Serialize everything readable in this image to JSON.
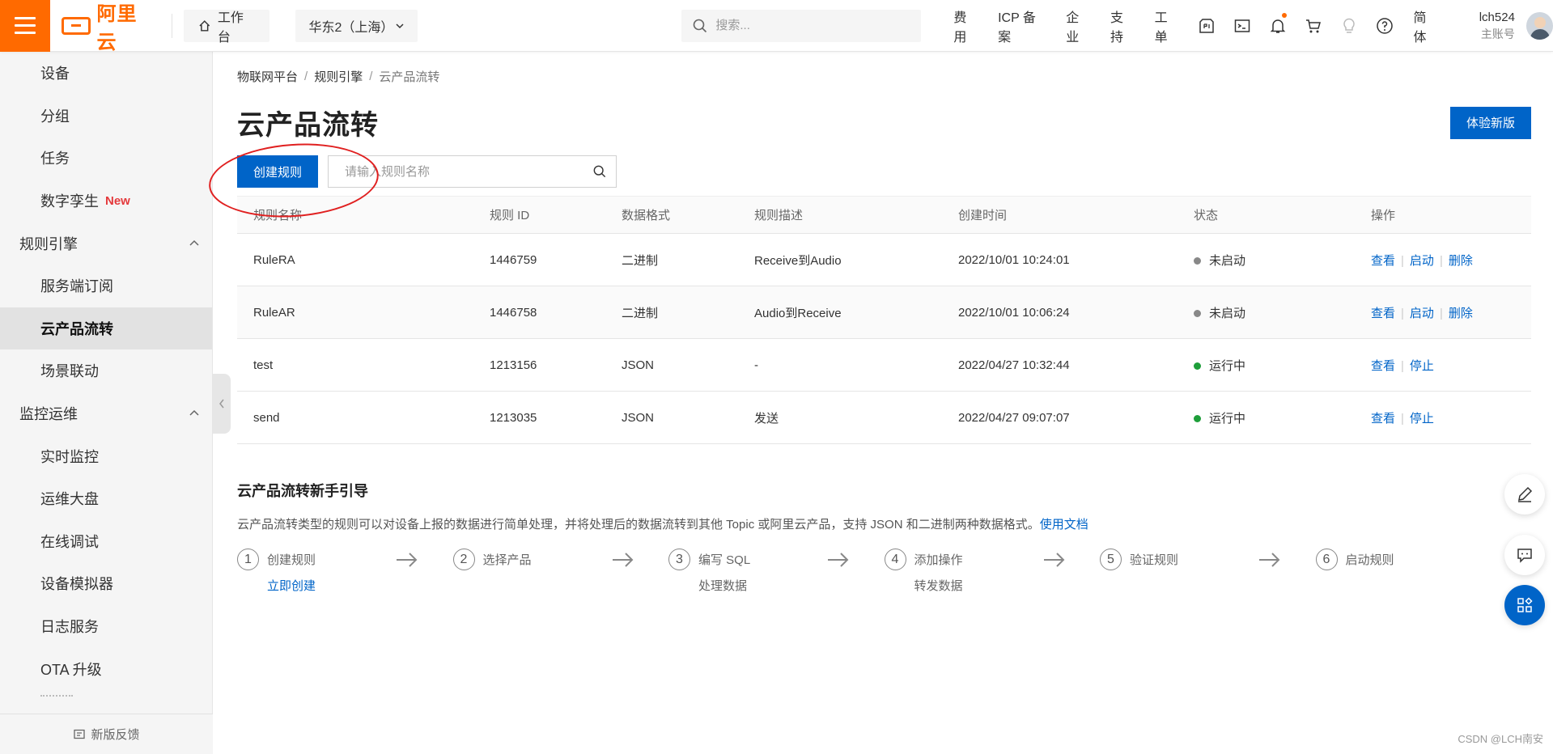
{
  "topbar": {
    "logo_text": "阿里云",
    "workbench": "工作台",
    "region": "华东2（上海）",
    "search_placeholder": "搜索...",
    "nav": [
      "费用",
      "ICP 备案",
      "企业",
      "支持",
      "工单"
    ],
    "lang": "简体",
    "account_name": "lch524",
    "account_role": "主账号",
    "accent": "#ff6a00"
  },
  "sidebar": {
    "items_top": [
      "设备",
      "分组",
      "任务"
    ],
    "digital_twin": "数字孪生",
    "new_badge": "New",
    "group_rules": "规则引擎",
    "rules_items": [
      "服务端订阅",
      "云产品流转",
      "场景联动"
    ],
    "group_ops": "监控运维",
    "ops_items": [
      "实时监控",
      "运维大盘",
      "在线调试",
      "设备模拟器",
      "日志服务",
      "OTA 升级"
    ],
    "feedback": "新版反馈"
  },
  "main": {
    "breadcrumb": [
      "物联网平台",
      "规则引擎",
      "云产品流转"
    ],
    "title": "云产品流转",
    "try_new_button": "体验新版",
    "create_button": "创建规则",
    "search_placeholder": "请输入规则名称",
    "primary_color": "#0064c8",
    "table": {
      "headers": [
        "规则名称",
        "规则 ID",
        "数据格式",
        "规则描述",
        "创建时间",
        "状态",
        "操作"
      ],
      "rows": [
        {
          "name": "RuleRA",
          "id": "1446759",
          "format": "二进制",
          "desc": "Receive到Audio",
          "created": "2022/10/01 10:24:01",
          "status": "未启动",
          "status_color": "#888888",
          "ops": [
            "查看",
            "启动",
            "删除"
          ]
        },
        {
          "name": "RuleAR",
          "id": "1446758",
          "format": "二进制",
          "desc": "Audio到Receive",
          "created": "2022/10/01 10:06:24",
          "status": "未启动",
          "status_color": "#888888",
          "ops": [
            "查看",
            "启动",
            "删除"
          ]
        },
        {
          "name": "test",
          "id": "1213156",
          "format": "JSON",
          "desc": "-",
          "created": "2022/04/27 10:32:44",
          "status": "运行中",
          "status_color": "#1e9e3a",
          "ops": [
            "查看",
            "停止"
          ]
        },
        {
          "name": "send",
          "id": "1213035",
          "format": "JSON",
          "desc": "发送",
          "created": "2022/04/27 09:07:07",
          "status": "运行中",
          "status_color": "#1e9e3a",
          "ops": [
            "查看",
            "停止"
          ]
        }
      ]
    },
    "guide": {
      "title": "云产品流转新手引导",
      "desc": "云产品流转类型的规则可以对设备上报的数据进行简单处理，并将处理后的数据流转到其他 Topic 或阿里云产品，支持 JSON 和二进制两种数据格式。",
      "doc_link": "使用文档",
      "steps": [
        {
          "num": "1",
          "label": "创建规则",
          "sub": "立即创建",
          "sub_link": true
        },
        {
          "num": "2",
          "label": "选择产品",
          "sub": "",
          "sub_link": false
        },
        {
          "num": "3",
          "label": "编写 SQL",
          "sub": "处理数据",
          "sub_link": false
        },
        {
          "num": "4",
          "label": "添加操作",
          "sub": "转发数据",
          "sub_link": false
        },
        {
          "num": "5",
          "label": "验证规则",
          "sub": "",
          "sub_link": false
        },
        {
          "num": "6",
          "label": "启动规则",
          "sub": "",
          "sub_link": false
        }
      ]
    }
  },
  "watermark": "CSDN @LCH南安"
}
